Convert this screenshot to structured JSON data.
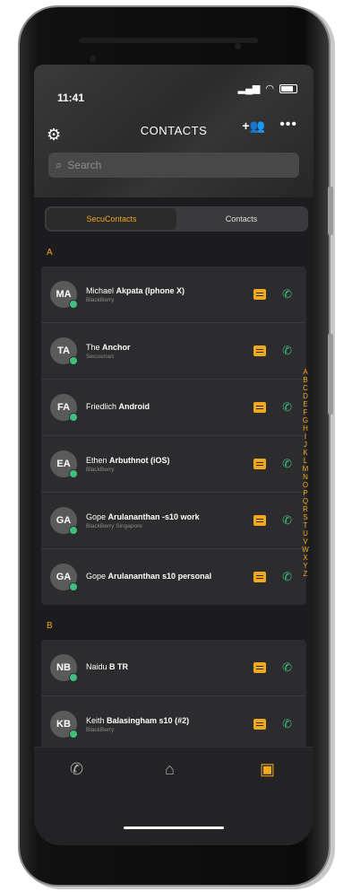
{
  "status": {
    "time": "11:41"
  },
  "header": {
    "title": "CONTACTS"
  },
  "search": {
    "placeholder": "Search"
  },
  "segments": {
    "secu": "SecuContacts",
    "contacts": "Contacts"
  },
  "sections": [
    {
      "letter": "A",
      "contacts": [
        {
          "initials": "MA",
          "first": "Michael",
          "last": "Akpata (Iphone X)",
          "sub": "BlackBerry"
        },
        {
          "initials": "TA",
          "first": "The",
          "last": "Anchor",
          "sub": "Secusmart"
        },
        {
          "initials": "FA",
          "first": "Friedlich",
          "last": "Android",
          "sub": ""
        },
        {
          "initials": "EA",
          "first": "Ethen",
          "last": "Arbuthnot (iOS)",
          "sub": "BlackBerry"
        },
        {
          "initials": "GA",
          "first": "Gope",
          "last": "Arulananthan -s10 work",
          "sub": "BlackBerry Singapore"
        },
        {
          "initials": "GA",
          "first": "Gope",
          "last": "Arulananthan s10 personal",
          "sub": ""
        }
      ]
    },
    {
      "letter": "B",
      "contacts": [
        {
          "initials": "NB",
          "first": "Naidu",
          "last": "B TR",
          "sub": ""
        },
        {
          "initials": "KB",
          "first": "Keith",
          "last": "Balasingham s10 (#2)",
          "sub": "BlackBerry"
        }
      ]
    }
  ],
  "index": [
    "A",
    "B",
    "C",
    "D",
    "E",
    "F",
    "G",
    "H",
    "I",
    "J",
    "K",
    "L",
    "M",
    "N",
    "O",
    "P",
    "Q",
    "R",
    "S",
    "T",
    "U",
    "V",
    "W",
    "X",
    "Y",
    "Z"
  ],
  "colors": {
    "accent": "#f0a81e",
    "call": "#3fbf7f",
    "background": "#1c1c1e"
  },
  "icons": {
    "settings": "gear-icon",
    "add": "add-contact-icon",
    "more": "more-icon",
    "message": "message-icon",
    "call": "phone-icon"
  }
}
